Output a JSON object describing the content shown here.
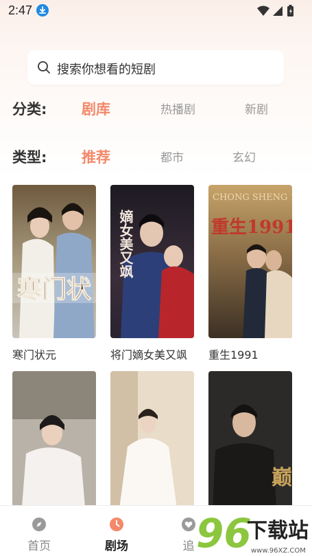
{
  "status_bar": {
    "time": "2:47"
  },
  "search": {
    "placeholder": "搜索你想看的短剧"
  },
  "filters": {
    "category": {
      "label": "分类:",
      "options": [
        "剧库",
        "热播剧",
        "新剧"
      ],
      "active_index": 0
    },
    "type": {
      "label": "类型:",
      "options": [
        "推荐",
        "都市",
        "玄幻"
      ],
      "active_index": 0
    }
  },
  "dramas": [
    {
      "title": "寒门状元",
      "poster_text": "寒门状"
    },
    {
      "title": "将门嫡女美又飒",
      "poster_text": "嫡女美又飒"
    },
    {
      "title": "重生1991",
      "poster_text": "重生1991",
      "poster_subtext": "CHONG SHENG 1991"
    },
    {
      "title": "",
      "poster_text": ""
    },
    {
      "title": "",
      "poster_text": ""
    },
    {
      "title": "",
      "poster_text": "巅"
    }
  ],
  "bottom_nav": {
    "items": [
      {
        "label": "首页",
        "icon": "compass-icon"
      },
      {
        "label": "剧场",
        "icon": "clock-icon"
      },
      {
        "label": "追",
        "icon": "heart-icon"
      }
    ],
    "active_index": 1
  },
  "watermark": {
    "number": "96",
    "text": "下载站",
    "url": "www.96XZ.COM"
  },
  "colors": {
    "accent": "#f3896a",
    "inactive": "#999999"
  }
}
